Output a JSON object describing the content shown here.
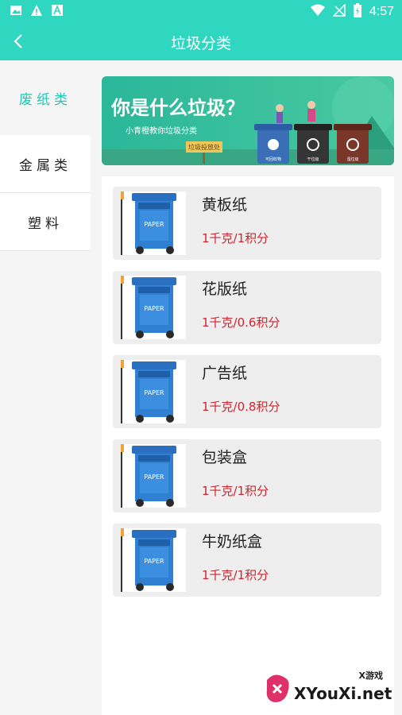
{
  "status_bar": {
    "time": "4:57"
  },
  "header": {
    "title": "垃圾分类"
  },
  "sidebar": {
    "items": [
      {
        "label": "废纸类",
        "active": true
      },
      {
        "label": "金属类",
        "active": false
      },
      {
        "label": "塑料",
        "active": false
      }
    ]
  },
  "banner": {
    "headline": "你是什么垃圾？",
    "subline": "小青橙教你垃圾分类",
    "sign": "垃圾投放处",
    "bin_labels": [
      "可回收物",
      "干垃圾",
      "湿垃圾"
    ]
  },
  "items": [
    {
      "name": "黄板纸",
      "price": "1千克/1积分",
      "bin_text": "PAPER"
    },
    {
      "name": "花版纸",
      "price": "1千克/0.6积分",
      "bin_text": "PAPER"
    },
    {
      "name": "广告纸",
      "price": "1千克/0.8积分",
      "bin_text": "PAPER"
    },
    {
      "name": "包装盒",
      "price": "1千克/1积分",
      "bin_text": "PAPER"
    },
    {
      "name": "牛奶纸盒",
      "price": "1千克/1积分",
      "bin_text": "PAPER"
    }
  ],
  "watermark": {
    "top": "X游戏",
    "main": "XYouXi.net"
  },
  "colors": {
    "accent": "#2fd6c0",
    "price": "#d0232f",
    "bin_blue": "#2f7fd3"
  }
}
